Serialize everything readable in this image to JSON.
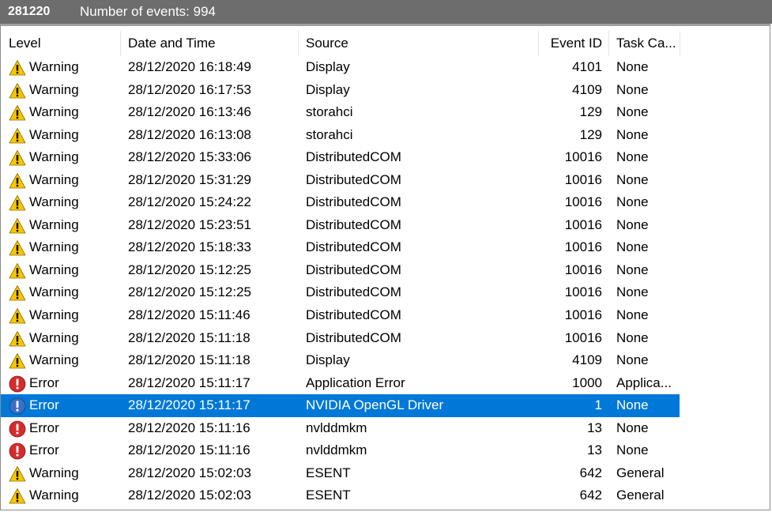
{
  "titlebar": {
    "log_name": "281220",
    "event_count": "Number of events: 994"
  },
  "columns": {
    "level": "Level",
    "datetime": "Date and Time",
    "source": "Source",
    "event_id": "Event ID",
    "task": "Task Ca..."
  },
  "rows": [
    {
      "level": "Warning",
      "icon": "warning-icon",
      "datetime": "28/12/2020 16:18:49",
      "source": "Display",
      "event_id": "4101",
      "task": "None"
    },
    {
      "level": "Warning",
      "icon": "warning-icon",
      "datetime": "28/12/2020 16:17:53",
      "source": "Display",
      "event_id": "4109",
      "task": "None"
    },
    {
      "level": "Warning",
      "icon": "warning-icon",
      "datetime": "28/12/2020 16:13:46",
      "source": "storahci",
      "event_id": "129",
      "task": "None"
    },
    {
      "level": "Warning",
      "icon": "warning-icon",
      "datetime": "28/12/2020 16:13:08",
      "source": "storahci",
      "event_id": "129",
      "task": "None"
    },
    {
      "level": "Warning",
      "icon": "warning-icon",
      "datetime": "28/12/2020 15:33:06",
      "source": "DistributedCOM",
      "event_id": "10016",
      "task": "None"
    },
    {
      "level": "Warning",
      "icon": "warning-icon",
      "datetime": "28/12/2020 15:31:29",
      "source": "DistributedCOM",
      "event_id": "10016",
      "task": "None"
    },
    {
      "level": "Warning",
      "icon": "warning-icon",
      "datetime": "28/12/2020 15:24:22",
      "source": "DistributedCOM",
      "event_id": "10016",
      "task": "None"
    },
    {
      "level": "Warning",
      "icon": "warning-icon",
      "datetime": "28/12/2020 15:23:51",
      "source": "DistributedCOM",
      "event_id": "10016",
      "task": "None"
    },
    {
      "level": "Warning",
      "icon": "warning-icon",
      "datetime": "28/12/2020 15:18:33",
      "source": "DistributedCOM",
      "event_id": "10016",
      "task": "None"
    },
    {
      "level": "Warning",
      "icon": "warning-icon",
      "datetime": "28/12/2020 15:12:25",
      "source": "DistributedCOM",
      "event_id": "10016",
      "task": "None"
    },
    {
      "level": "Warning",
      "icon": "warning-icon",
      "datetime": "28/12/2020 15:12:25",
      "source": "DistributedCOM",
      "event_id": "10016",
      "task": "None"
    },
    {
      "level": "Warning",
      "icon": "warning-icon",
      "datetime": "28/12/2020 15:11:46",
      "source": "DistributedCOM",
      "event_id": "10016",
      "task": "None"
    },
    {
      "level": "Warning",
      "icon": "warning-icon",
      "datetime": "28/12/2020 15:11:18",
      "source": "DistributedCOM",
      "event_id": "10016",
      "task": "None"
    },
    {
      "level": "Warning",
      "icon": "warning-icon",
      "datetime": "28/12/2020 15:11:18",
      "source": "Display",
      "event_id": "4109",
      "task": "None"
    },
    {
      "level": "Error",
      "icon": "error-icon",
      "datetime": "28/12/2020 15:11:17",
      "source": "Application Error",
      "event_id": "1000",
      "task": "Applica..."
    },
    {
      "level": "Error",
      "icon": "error-icon",
      "datetime": "28/12/2020 15:11:17",
      "source": "NVIDIA OpenGL Driver",
      "event_id": "1",
      "task": "None",
      "selected": true
    },
    {
      "level": "Error",
      "icon": "error-icon",
      "datetime": "28/12/2020 15:11:16",
      "source": "nvlddmkm",
      "event_id": "13",
      "task": "None"
    },
    {
      "level": "Error",
      "icon": "error-icon",
      "datetime": "28/12/2020 15:11:16",
      "source": "nvlddmkm",
      "event_id": "13",
      "task": "None"
    },
    {
      "level": "Warning",
      "icon": "warning-icon",
      "datetime": "28/12/2020 15:02:03",
      "source": "ESENT",
      "event_id": "642",
      "task": "General"
    },
    {
      "level": "Warning",
      "icon": "warning-icon",
      "datetime": "28/12/2020 15:02:03",
      "source": "ESENT",
      "event_id": "642",
      "task": "General"
    }
  ],
  "colors": {
    "titlebar_bg": "#6d6d6d",
    "selection": "#0078d7",
    "warning": "#f7c600",
    "error": "#d42c2c",
    "error_selected": "#3a6fc4"
  }
}
